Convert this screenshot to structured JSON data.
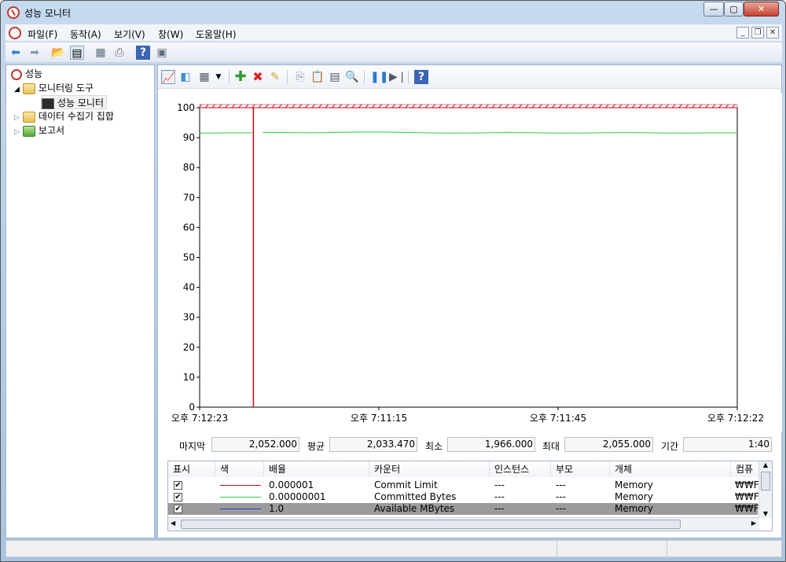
{
  "window": {
    "title": "성능 모니터"
  },
  "menu": [
    "파일(F)",
    "동작(A)",
    "보기(V)",
    "창(W)",
    "도움말(H)"
  ],
  "tree": {
    "root": "성능",
    "tools": "모니터링 도구",
    "monitor": "성능 모니터",
    "collectors": "데이터 수집기 집합",
    "reports": "보고서"
  },
  "chart_data": {
    "type": "line",
    "ylim": [
      0,
      100
    ],
    "yticks": [
      0,
      10,
      20,
      30,
      40,
      50,
      60,
      70,
      80,
      90,
      100
    ],
    "xticks": [
      "오후 7:12:23",
      "오후 7:11:15",
      "오후 7:11:45",
      "오후 7:12:22"
    ],
    "series": [
      {
        "color": "#2ecc40",
        "values": [
          91.5,
          91.6,
          91.5,
          91.7,
          91.6,
          91.8,
          91.9,
          91.8,
          91.6,
          91.5,
          91.6,
          91.7,
          91.6,
          91.5,
          91.6,
          91.7,
          91.6,
          91.5,
          91.6,
          91.6
        ]
      },
      {
        "color": "#d0021b",
        "values": [
          100,
          100,
          100,
          100,
          100,
          100,
          100,
          100,
          100,
          100,
          100,
          100,
          100,
          100,
          100,
          100,
          100,
          100,
          100,
          100
        ]
      }
    ],
    "cursor_fraction": 0.1
  },
  "stats": {
    "last_label": "마지막",
    "last": "2,052.000",
    "avg_label": "평균",
    "avg": "2,033.470",
    "min_label": "최소",
    "min": "1,966.000",
    "max_label": "최대",
    "max": "2,055.000",
    "dur_label": "기간",
    "dur": "1:40"
  },
  "counter_headers": [
    "표시",
    "색",
    "배율",
    "카운터",
    "인스턴스",
    "부모",
    "개체",
    "컴퓨"
  ],
  "counters": [
    {
      "check": "✔",
      "color": "#d0021b",
      "scale": "0.000001",
      "counter": "Commit Limit",
      "instance": "---",
      "parent": "---",
      "object": "Memory",
      "computer": "₩₩FX"
    },
    {
      "check": "✔",
      "color": "#2ecc40",
      "scale": "0.00000001",
      "counter": "Committed Bytes",
      "instance": "---",
      "parent": "---",
      "object": "Memory",
      "computer": "₩₩FX"
    },
    {
      "check": "✔",
      "color": "#1f3fd1",
      "scale": "1.0",
      "counter": "Available MBytes",
      "instance": "---",
      "parent": "---",
      "object": "Memory",
      "computer": "₩₩FX"
    }
  ]
}
